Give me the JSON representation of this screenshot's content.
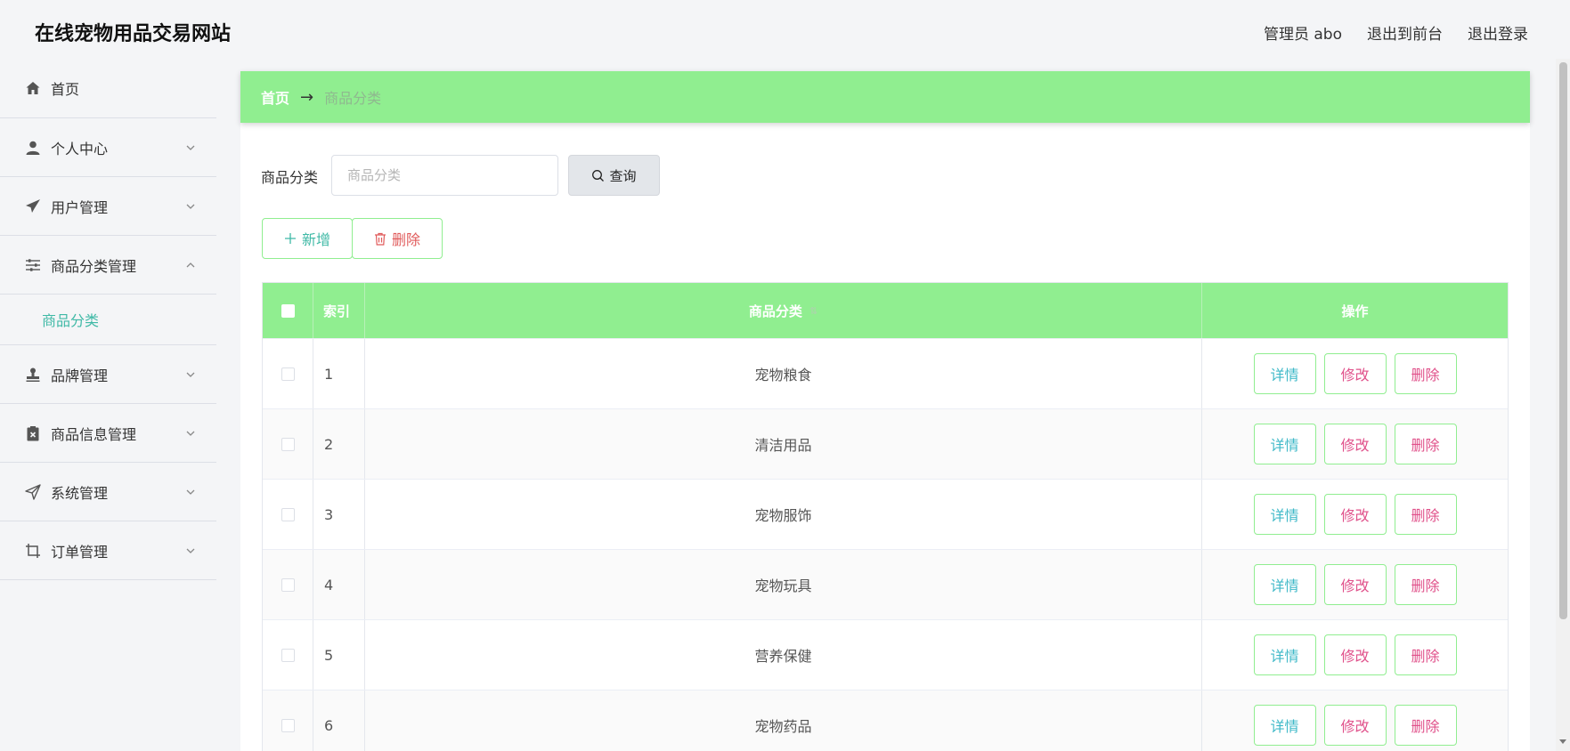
{
  "header": {
    "site_title": "在线宠物用品交易网站",
    "admin_label": "管理员 abo",
    "to_front_label": "退出到前台",
    "logout_label": "退出登录"
  },
  "sidebar": {
    "items": [
      {
        "label": "首页",
        "icon": "home-icon",
        "expandable": false
      },
      {
        "label": "个人中心",
        "icon": "user-icon",
        "expandable": true
      },
      {
        "label": "用户管理",
        "icon": "paper-plane-icon",
        "expandable": true
      },
      {
        "label": "商品分类管理",
        "icon": "sliders-icon",
        "expandable": true,
        "expanded": true
      },
      {
        "label": "品牌管理",
        "icon": "stamp-icon",
        "expandable": true
      },
      {
        "label": "商品信息管理",
        "icon": "clipboard-x-icon",
        "expandable": true
      },
      {
        "label": "系统管理",
        "icon": "send-icon",
        "expandable": true
      },
      {
        "label": "订单管理",
        "icon": "crop-icon",
        "expandable": true
      }
    ],
    "sub_item": "商品分类"
  },
  "breadcrumb": {
    "home": "首页",
    "arrow": "→",
    "current": "商品分类"
  },
  "search": {
    "label": "商品分类",
    "placeholder": "商品分类",
    "value": "",
    "button_label": "查询"
  },
  "actions": {
    "add_label": "新增",
    "delete_label": "删除"
  },
  "table": {
    "columns": [
      "索引",
      "商品分类",
      "操作"
    ],
    "rows": [
      {
        "index": "1",
        "name": "宠物粮食"
      },
      {
        "index": "2",
        "name": "清洁用品"
      },
      {
        "index": "3",
        "name": "宠物服饰"
      },
      {
        "index": "4",
        "name": "宠物玩具"
      },
      {
        "index": "5",
        "name": "营养保健"
      },
      {
        "index": "6",
        "name": "宠物药品"
      }
    ],
    "row_actions": {
      "detail": "详情",
      "edit": "修改",
      "remove": "删除"
    }
  },
  "colors": {
    "accent_green": "#90ee90",
    "teal_text": "#3fb9a6",
    "danger_text": "#e05a5a",
    "pink_text": "#e0508a"
  }
}
